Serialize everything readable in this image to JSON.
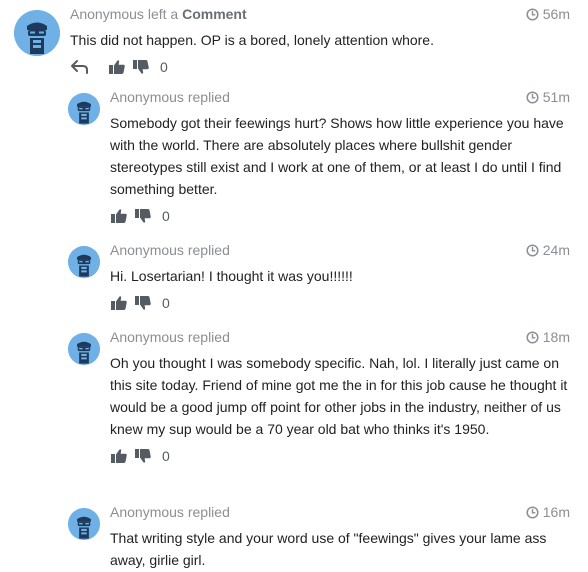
{
  "comments": [
    {
      "author": "Anonymous",
      "action": "left a",
      "target": "Comment",
      "time": "56m",
      "text": "This did not happen. OP is a bored, lonely attention whore.",
      "votes": "0"
    },
    {
      "author": "Anonymous",
      "action": "replied",
      "target": "",
      "time": "51m",
      "text": "Somebody got their feewings hurt? Shows how little experience you have with the world. There are absolutely places where bullshit gender stereotypes still exist and I work at one of them, or at least I do until I find something better.",
      "votes": "0"
    },
    {
      "author": "Anonymous",
      "action": "replied",
      "target": "",
      "time": "24m",
      "text": "Hi. Losertarian! I thought it was you!!!!!!",
      "votes": "0"
    },
    {
      "author": "Anonymous",
      "action": "replied",
      "target": "",
      "time": "18m",
      "text": "Oh you thought I was somebody specific. Nah, lol. I literally just came on this site today. Friend of mine got me the in for this job cause he thought it would be a good jump off point for other jobs in the industry, neither of us knew my sup would be a 70 year old bat who thinks it's 1950.",
      "votes": "0"
    },
    {
      "author": "Anonymous",
      "action": "replied",
      "target": "",
      "time": "16m",
      "text": "That writing style and your word use of \"feewings\" gives your lame ass away, girlie girl.",
      "votes": ""
    }
  ],
  "icons": {
    "avatar": "anonymous-avatar-icon",
    "clock": "clock-icon",
    "reply": "reply-icon",
    "thumbs_up": "thumbs-up-icon",
    "thumbs_down": "thumbs-down-icon"
  },
  "colors": {
    "avatar_bg": "#6fb0e6",
    "meta_text": "#8a8f96",
    "body_text": "#222222"
  }
}
